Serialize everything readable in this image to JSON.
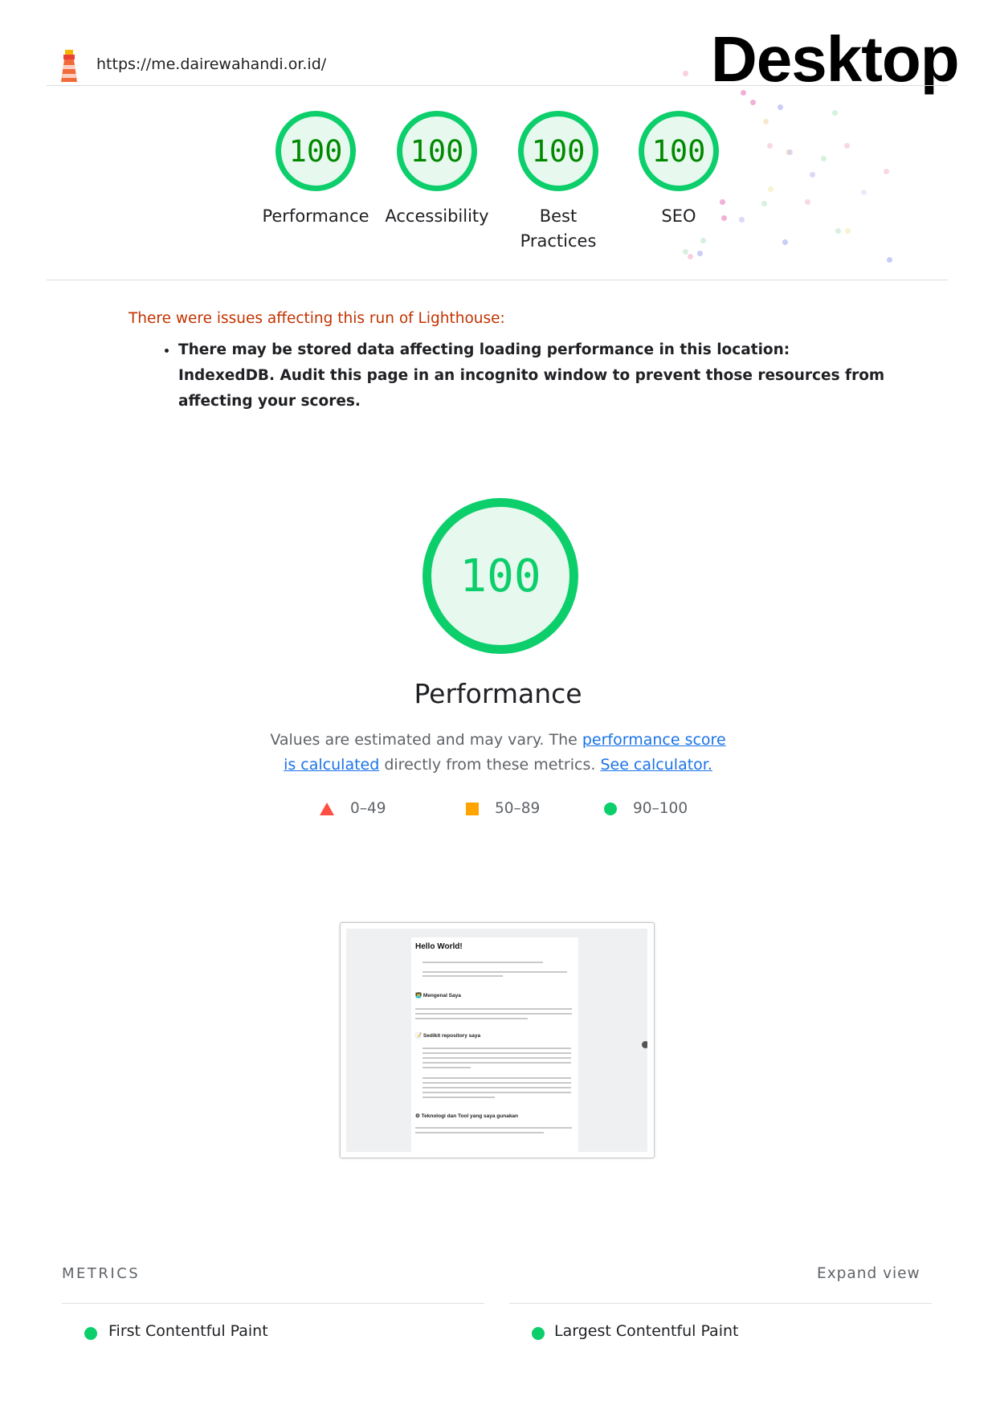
{
  "header": {
    "url": "https://me.dairewahandi.or.id/",
    "device": "Desktop"
  },
  "gauges": [
    {
      "label": "Performance",
      "score": "100"
    },
    {
      "label": "Accessibility",
      "score": "100"
    },
    {
      "label": "Best Practices",
      "score": "100"
    },
    {
      "label": "SEO",
      "score": "100"
    }
  ],
  "warnings": {
    "title": "There were issues affecting this run of Lighthouse:",
    "items": [
      "There may be stored data affecting loading performance in this location: IndexedDB. Audit this page in an incognito window to prevent those resources from affecting your scores."
    ]
  },
  "performance": {
    "score": "100",
    "title": "Performance",
    "desc_prefix": "Values are estimated and may vary. The ",
    "desc_link1": "performance score is calculated",
    "desc_middle": " directly from these metrics. ",
    "desc_link2": "See calculator."
  },
  "legend": {
    "fail": "0–49",
    "average": "50–89",
    "pass": "90–100"
  },
  "thumbnail": {
    "heading": "Hello World!",
    "section1": "👨‍💻 Mengenal Saya",
    "section2": "📝 Sedikit repository saya",
    "section3": "⚙ Teknologi dan Tool yang saya gunakan"
  },
  "metrics": {
    "header": "METRICS",
    "expand": "Expand view",
    "items": [
      "First Contentful Paint",
      "Largest Contentful Paint"
    ]
  },
  "colors": {
    "pass": "#0cce6b",
    "pass_text": "#008800",
    "fail": "#ff4e42",
    "warning_text": "#c33300",
    "link": "#1a73e8"
  }
}
